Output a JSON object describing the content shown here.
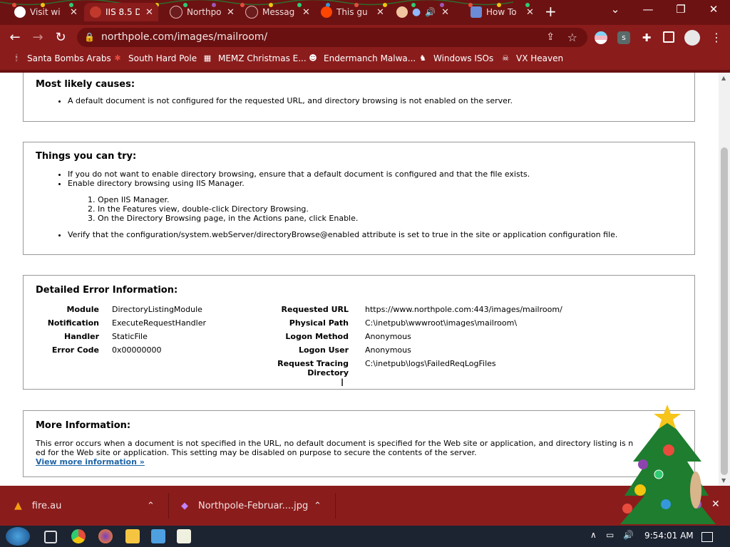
{
  "browser": {
    "tabs": [
      {
        "title": "Visit wi",
        "color": "#ffffff"
      },
      {
        "title": "IIS 8.5 D",
        "color": "#c0392b",
        "active": true
      },
      {
        "title": "Northpo",
        "color": "#6b1d1d"
      },
      {
        "title": "Messag",
        "color": "#6b1d1d"
      },
      {
        "title": "This gu",
        "color": "#ff4500"
      },
      {
        "title": "",
        "color": "#f0c6a0"
      },
      {
        "title": "How To",
        "color": "#6b8bd6"
      }
    ],
    "new_tab": "+",
    "window": {
      "minimize": "—",
      "restore": "❐",
      "close": "✕",
      "tabsearch": "⌄"
    },
    "address": "northpole.com/images/mailroom/",
    "bookmarks": [
      {
        "label": "Santa Bombs Arabs",
        "icon": "🕯"
      },
      {
        "label": "South Hard Pole",
        "icon": "✱"
      },
      {
        "label": "MEMZ Christmas E...",
        "icon": "▦"
      },
      {
        "label": "Endermanch Malwa...",
        "icon": "☻"
      },
      {
        "label": "Windows ISOs",
        "icon": "♞"
      },
      {
        "label": "VX Heaven",
        "icon": "☠"
      }
    ]
  },
  "page": {
    "causes": {
      "title": "Most likely causes:",
      "items": [
        "A default document is not configured for the requested URL, and directory browsing is not enabled on the server."
      ]
    },
    "try": {
      "title": "Things you can try:",
      "items": [
        "If you do not want to enable directory browsing, ensure that a default document is configured and that the file exists.",
        "Enable directory browsing using IIS Manager."
      ],
      "steps": [
        "1. Open IIS Manager.",
        "2. In the Features view, double-click Directory Browsing.",
        "3. On the Directory Browsing page, in the Actions pane, click Enable."
      ],
      "last": "Verify that the configuration/system.webServer/directoryBrowse@enabled attribute is set to true in the site or application configuration file."
    },
    "detail": {
      "title": "Detailed Error Information:",
      "left": [
        {
          "label": "Module",
          "value": "DirectoryListingModule"
        },
        {
          "label": "Notification",
          "value": "ExecuteRequestHandler"
        },
        {
          "label": "Handler",
          "value": "StaticFile"
        },
        {
          "label": "Error Code",
          "value": "0x00000000"
        }
      ],
      "right": [
        {
          "label": "Requested URL",
          "value": "https://www.northpole.com:443/images/mailroom/"
        },
        {
          "label": "Physical Path",
          "value": "C:\\inetpub\\wwwroot\\images\\mailroom\\"
        },
        {
          "label": "Logon Method",
          "value": "Anonymous"
        },
        {
          "label": "Logon User",
          "value": "Anonymous"
        },
        {
          "label": "Request Tracing",
          "label2": "Directory",
          "value": "C:\\inetpub\\logs\\FailedReqLogFiles"
        }
      ]
    },
    "more": {
      "title": "More Information:",
      "line1": "This error occurs when a document is not specified in the URL, no default document is specified for the Web site or application, and directory listing is n",
      "line2": "ed for the Web site or application. This setting may be disabled on purpose to secure the contents of the server.",
      "link": "View more information »"
    }
  },
  "downloads": [
    {
      "name": "fire.au",
      "icon": "▲",
      "icon_color": "#f39c12"
    },
    {
      "name": "Northpole-Februar....jpg",
      "icon": "◆",
      "icon_color": "#c084fc"
    }
  ],
  "downloads_close": "✕",
  "taskbar": {
    "clock": "9:54:01 AM",
    "tray": [
      "∧",
      "▭",
      "🔊"
    ]
  },
  "colors": {
    "chrome": "#8b1c1c",
    "chrome_dark": "#6a1010",
    "link": "#1f65a8"
  }
}
